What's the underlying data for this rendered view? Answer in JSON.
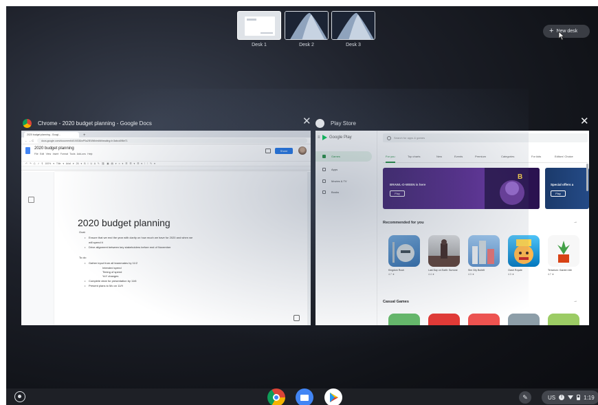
{
  "desks": [
    {
      "label": "Desk 1",
      "active": true
    },
    {
      "label": "Desk 2",
      "active": false
    },
    {
      "label": "Desk 3",
      "active": false
    }
  ],
  "new_desk": {
    "label": "New desk",
    "icon": "plus-icon"
  },
  "windows": {
    "chrome": {
      "title": "Chrome - 2020 budget planning - Google Docs",
      "app_icon": "chrome-icon",
      "tab_title": "2020 budget planning - Googl...",
      "url": "docs.google.com/document/d/1XlG8JwP0a2lE4Wb/edit#heading=h.5abcd0f6e71",
      "doc": {
        "name": "2020 budget planning",
        "menu": "File Edit View Insert Format Tools Add-ons Help",
        "status": "See new changes",
        "share_label": "Share",
        "toolbar": "↶ ↷ ⎙ ✓ ¶ 100% ▾ Title ▾ Arial ▾ 26 ▾ B I U A ✎ ⛓ ▣ ▤ ▾ ≡ ▾ ☰ ☰ ▾ ☰ ▾ ⁝ ⁝ ✎ ▾",
        "heading": "2020 budget planning",
        "goal_label": "Goal:",
        "goal_items": [
          "Ensure that we end the year with clarity on how much we have for 2020 and when we",
          "will spend it",
          "Drive alignment between key stakeholders before end of November"
        ],
        "todo_label": "To do:",
        "todo_items": [
          "Gather input from all teammates by 11/2",
          "Intended spend",
          "Timing of spend",
          "YoY changes",
          "Complete deck for presentation by 11/6",
          "Present plans to Mo on 11/9"
        ]
      }
    },
    "play": {
      "title": "Play Store",
      "app_icon": "play-store-icon",
      "logo": "Google Play",
      "search_placeholder": "Search for apps & games",
      "sidebar": [
        "Games",
        "Apps",
        "Movies & TV",
        "Books"
      ],
      "tabs": [
        "For you",
        "Top charts",
        "New",
        "Events",
        "Premium",
        "Categories",
        "For kids",
        "Editors' Choice"
      ],
      "banner_text": "BRAWL-O-WEEN is here",
      "banner_button": "Play",
      "banner2_text": "Special offers a",
      "banner2_button": "Play",
      "sections": [
        {
          "title": "Recommended for you",
          "apps": [
            {
              "name": "Kingdom Rush",
              "rating": "4.7 ★"
            },
            {
              "name": "Last Day on Earth: Survival",
              "rating": "4.4 ★"
            },
            {
              "name": "Sim City BuildIt",
              "rating": "4.3 ★"
            },
            {
              "name": "Clash Royale",
              "rating": "4.3 ★"
            },
            {
              "name": "Terrarium: Garden Idle",
              "rating": "4.7 ★"
            }
          ]
        },
        {
          "title": "Casual Games",
          "apps": []
        }
      ]
    }
  },
  "shelf": {
    "apps": [
      "chrome-icon",
      "files-icon",
      "play-store-icon"
    ],
    "tray": {
      "locale": "US",
      "time": "1:19"
    }
  },
  "colors": {
    "accent_green": "#1e8e3e",
    "share_blue": "#1a73e8",
    "play_banner": "#4a1f7a"
  }
}
